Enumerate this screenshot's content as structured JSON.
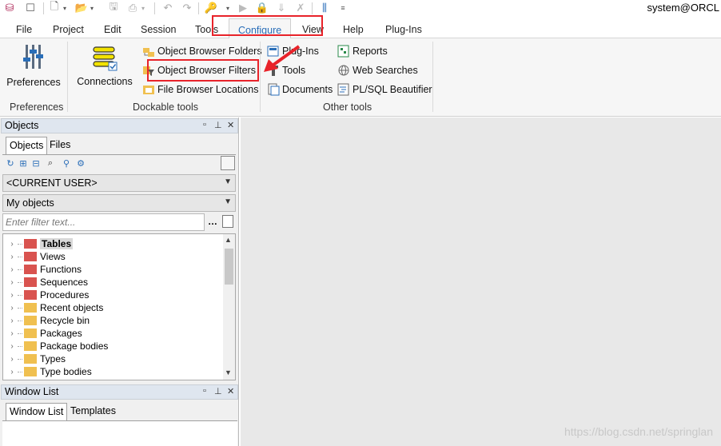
{
  "window": {
    "title": "system@ORCL"
  },
  "ribbon_tabs": [
    "File",
    "Project",
    "Edit",
    "Session",
    "Tools",
    "Configure",
    "View",
    "Help",
    "Plug-Ins"
  ],
  "active_tab": "Configure",
  "ribbon": {
    "preferences": {
      "button": "Preferences",
      "group": "Preferences"
    },
    "dockable": {
      "connections": "Connections",
      "object_browser_folders": "Object Browser Folders",
      "object_browser_filters": "Object Browser Filters",
      "file_browser_locations": "File Browser Locations",
      "group": "Dockable tools"
    },
    "other": {
      "plugins": "Plug-Ins",
      "tools": "Tools",
      "documents": "Documents",
      "reports": "Reports",
      "web_searches": "Web Searches",
      "plsql_beautifier": "PL/SQL Beautifier",
      "group": "Other tools"
    }
  },
  "objects_panel": {
    "title": "Objects",
    "tabs": [
      "Objects",
      "Files"
    ],
    "user_combo": "<CURRENT USER>",
    "scope_combo": "My objects",
    "filter_placeholder": "Enter filter text...",
    "tree_items": [
      "Tables",
      "Views",
      "Functions",
      "Sequences",
      "Procedures",
      "Recent objects",
      "Recycle bin",
      "Packages",
      "Package bodies",
      "Types",
      "Type bodies"
    ],
    "tree_colors": [
      "#d9534f",
      "#d9534f",
      "#d9534f",
      "#d9534f",
      "#d9534f",
      "#f0c050",
      "#f0c050",
      "#f0c050",
      "#f0c050",
      "#f0c050",
      "#f0c050"
    ]
  },
  "window_list_panel": {
    "title": "Window List",
    "tabs": [
      "Window List",
      "Templates"
    ]
  },
  "watermark": "https://blog.csdn.net/springlan",
  "colors": {
    "highlight": "#e8232a",
    "active_tab_text": "#2a6eb8"
  }
}
